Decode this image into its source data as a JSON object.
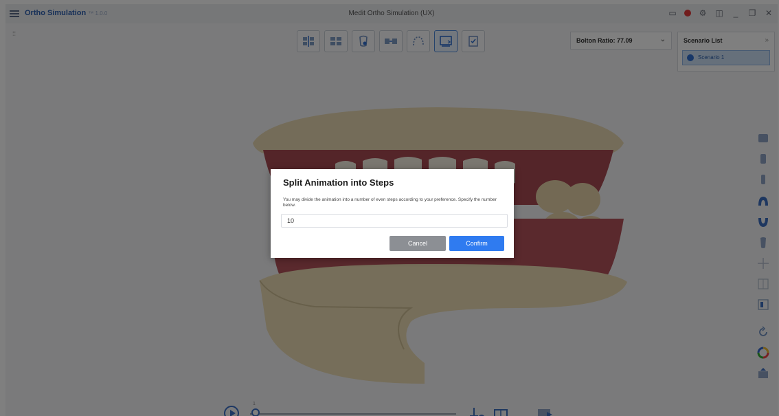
{
  "window": {
    "app_name": "Ortho Simulation",
    "version_suffix": "™ 1.0.0",
    "title": "Medit Ortho Simulation (UX)"
  },
  "toolbar": {
    "buttons": [
      {
        "icon": "arch-align-icon"
      },
      {
        "icon": "tooth-grid-icon"
      },
      {
        "icon": "tooth-select-icon"
      },
      {
        "icon": "spacing-icon"
      },
      {
        "icon": "arch-curve-icon"
      },
      {
        "icon": "animation-steps-icon",
        "active": true
      },
      {
        "icon": "checklist-icon"
      }
    ]
  },
  "bolton": {
    "label": "Bolton Ratio: 77.09"
  },
  "scenario_list": {
    "header": "Scenario List",
    "items": [
      {
        "label": "Scenario 1"
      }
    ]
  },
  "right_tools": [
    "front-view-icon",
    "side-view-icon",
    "back-view-icon",
    "upper-arch-icon",
    "lower-arch-icon",
    "tooth-icon",
    "crosshair-icon",
    "grid-icon",
    "split-view-icon",
    "rotate-icon",
    "color-wheel-icon",
    "export-icon"
  ],
  "timeline": {
    "marker": "1"
  },
  "dialog": {
    "title": "Split Animation into Steps",
    "description": "You may divide the animation into a number of even steps according to your preference. Specify the number below.",
    "input_value": "10",
    "cancel_label": "Cancel",
    "confirm_label": "Confirm"
  },
  "colors": {
    "accent": "#2f7bf0",
    "cancel": "#8c8f94",
    "gum": "#b0505a",
    "base": "#efe0b8"
  }
}
